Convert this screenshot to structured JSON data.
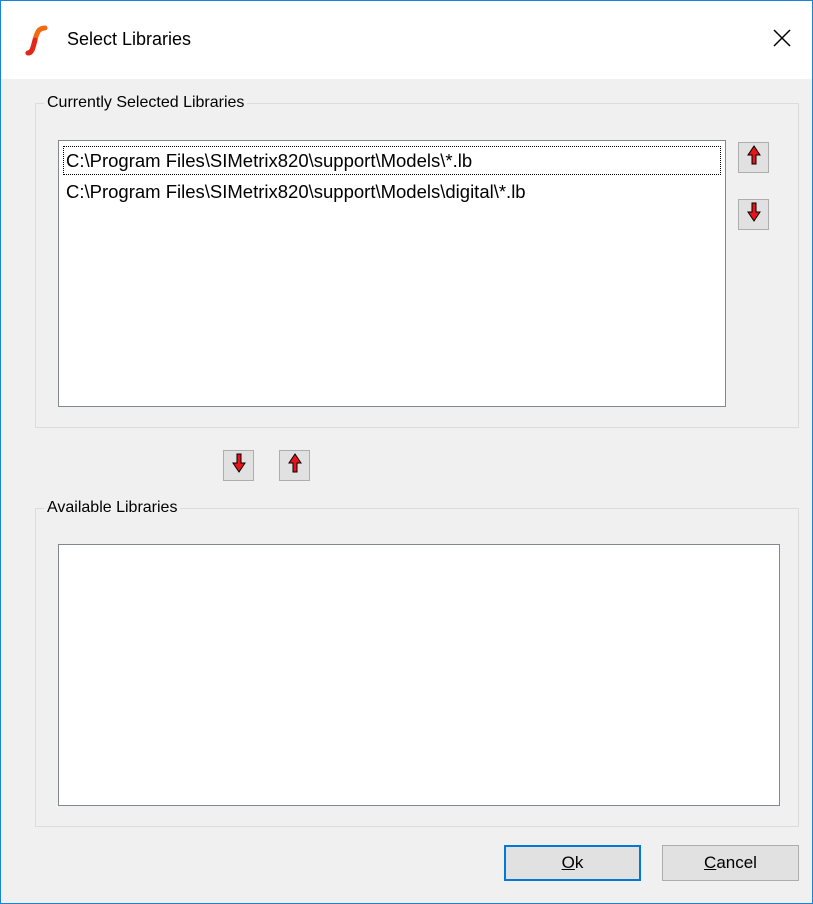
{
  "window": {
    "title": "Select Libraries",
    "accent_color": "#1883d7"
  },
  "currently_selected": {
    "group_label": "Currently Selected Libraries",
    "items": [
      "C:\\Program Files\\SIMetrix820\\support\\Models\\*.lb",
      "C:\\Program Files\\SIMetrix820\\support\\Models\\digital\\*.lb"
    ]
  },
  "available": {
    "group_label": "Available Libraries",
    "items": []
  },
  "icons": {
    "app": "simetrix-logo-icon",
    "close": "close-icon",
    "move_up": "red-arrow-up-icon",
    "move_down": "red-arrow-down-icon"
  },
  "buttons": {
    "ok": {
      "accel": "O",
      "rest": "k"
    },
    "cancel": {
      "accel": "C",
      "rest": "ancel"
    }
  },
  "colors": {
    "arrow_red": "#e8141b",
    "default_button_border": "#0078d7"
  }
}
